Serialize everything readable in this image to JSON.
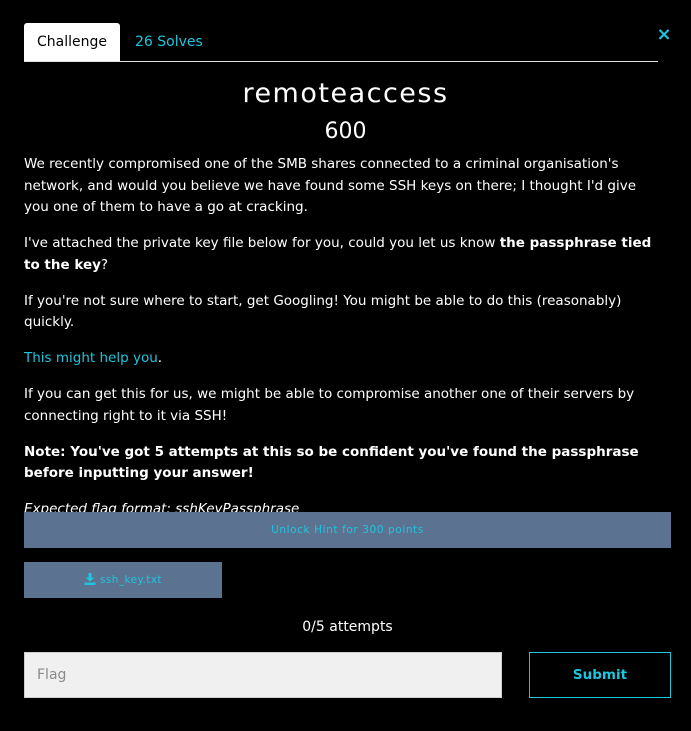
{
  "tabs": [
    {
      "label": "Challenge",
      "active": true
    },
    {
      "label": "26 Solves",
      "active": false
    }
  ],
  "close_icon": "×",
  "challenge": {
    "name": "remoteaccess",
    "points": "600"
  },
  "description": {
    "p1": "We recently compromised one of the SMB shares connected to a criminal organisation's network, and would you believe we have found some SSH keys on there; I thought I'd give you one of them to have a go at cracking.",
    "p2_text": "I've attached the private key file below for you, could you let us know ",
    "p2_bold": "the passphrase tied to the key",
    "p2_end": "?",
    "p3": "If you're not sure where to start, get Googling! You might be able to do this (reasonably) quickly.",
    "p4_link": "This might help you",
    "p4_end": ".",
    "p5": "If you can get this for us, we might be able to compromise another one of their servers by connecting right to it via SSH!",
    "p6_bold": "Note: You've got 5 attempts at this so be confident you've found the passphrase before inputting your answer!",
    "p7_italic": "Expected flag format: sshKeyPassphrase"
  },
  "hint_button": "Unlock Hint for 300 points",
  "file_button": {
    "icon": "download-icon",
    "label": "ssh_key.txt"
  },
  "attempts": "0/5 attempts",
  "flag_input": {
    "value": "",
    "placeholder": "Flag"
  },
  "submit_label": "Submit",
  "colors": {
    "accent": "#1dc5de",
    "background": "#000000",
    "button_bg": "#5b7390",
    "input_bg": "#f0f0f0"
  }
}
